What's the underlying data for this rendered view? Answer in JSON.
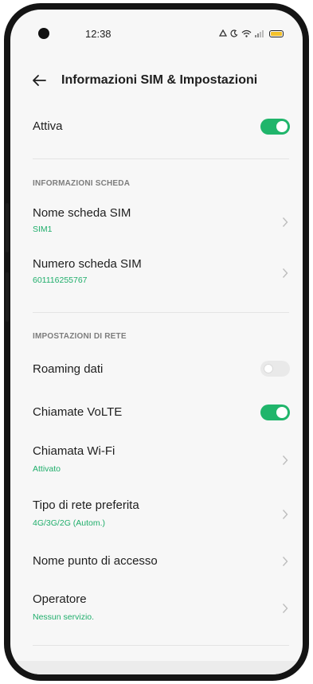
{
  "status_bar": {
    "time": "12:38"
  },
  "header": {
    "title": "Informazioni SIM & Impostazioni"
  },
  "active": {
    "label": "Attiva",
    "enabled": true
  },
  "sections": {
    "card_info": "INFORMAZIONI SCHEDA",
    "network_settings": "IMPOSTAZIONI DI RETE"
  },
  "card_info": {
    "sim_name": {
      "label": "Nome scheda SIM",
      "value": "SIM1"
    },
    "sim_number": {
      "label": "Numero scheda SIM",
      "value": "601116255767"
    }
  },
  "network": {
    "data_roaming": {
      "label": "Roaming dati",
      "enabled": false
    },
    "volte": {
      "label": "Chiamate VoLTE",
      "enabled": true
    },
    "wifi_calling": {
      "label": "Chiamata Wi-Fi",
      "value": "Attivato"
    },
    "preferred_network": {
      "label": "Tipo di rete preferita",
      "value": "4G/3G/2G (Autom.)"
    },
    "apn": {
      "label": "Nome punto di accesso"
    },
    "operator": {
      "label": "Operatore",
      "value": "Nessun servizio."
    }
  },
  "colors": {
    "accent": "#20b56b",
    "subtext": "#1fae6b",
    "battery": "#f4c22a"
  },
  "icons": [
    "back-arrow-icon",
    "chevron-right-icon",
    "signal-icon",
    "wifi-icon",
    "battery-icon"
  ]
}
